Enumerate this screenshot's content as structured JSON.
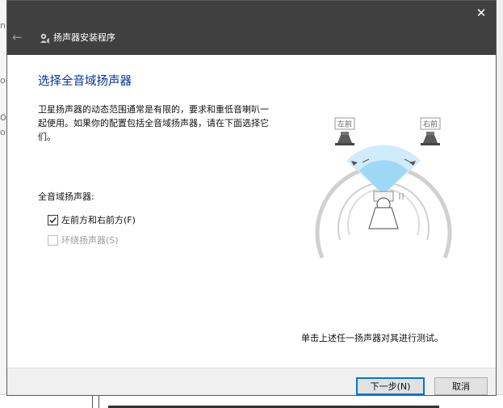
{
  "window": {
    "title": "扬声器安装程序",
    "close_glyph": "✕",
    "back_glyph": "←"
  },
  "page": {
    "heading": "选择全音域扬声器",
    "intro": "卫星扬声器的动态范围通常是有限的，要求和重低音喇叭一起使用。如果你的配置包括全音域扬声器，请在下面选择它们。",
    "group_label": "全音域扬声器:",
    "options": [
      {
        "label": "左前方和右前方(F)",
        "checked": true,
        "enabled": true
      },
      {
        "label": "环绕扬声器(S)",
        "checked": false,
        "enabled": false
      }
    ],
    "hint": "单击上述任一扬声器对其进行测试。"
  },
  "diagram": {
    "speaker_left_label": "左前",
    "speaker_right_label": "右前"
  },
  "footer": {
    "next_label": "下一步(N)",
    "cancel_label": "取消"
  },
  "colors": {
    "titlebar": "#404040",
    "heading": "#003399",
    "accent": "#0078d7",
    "listening_zone": "#9fd8f5"
  }
}
